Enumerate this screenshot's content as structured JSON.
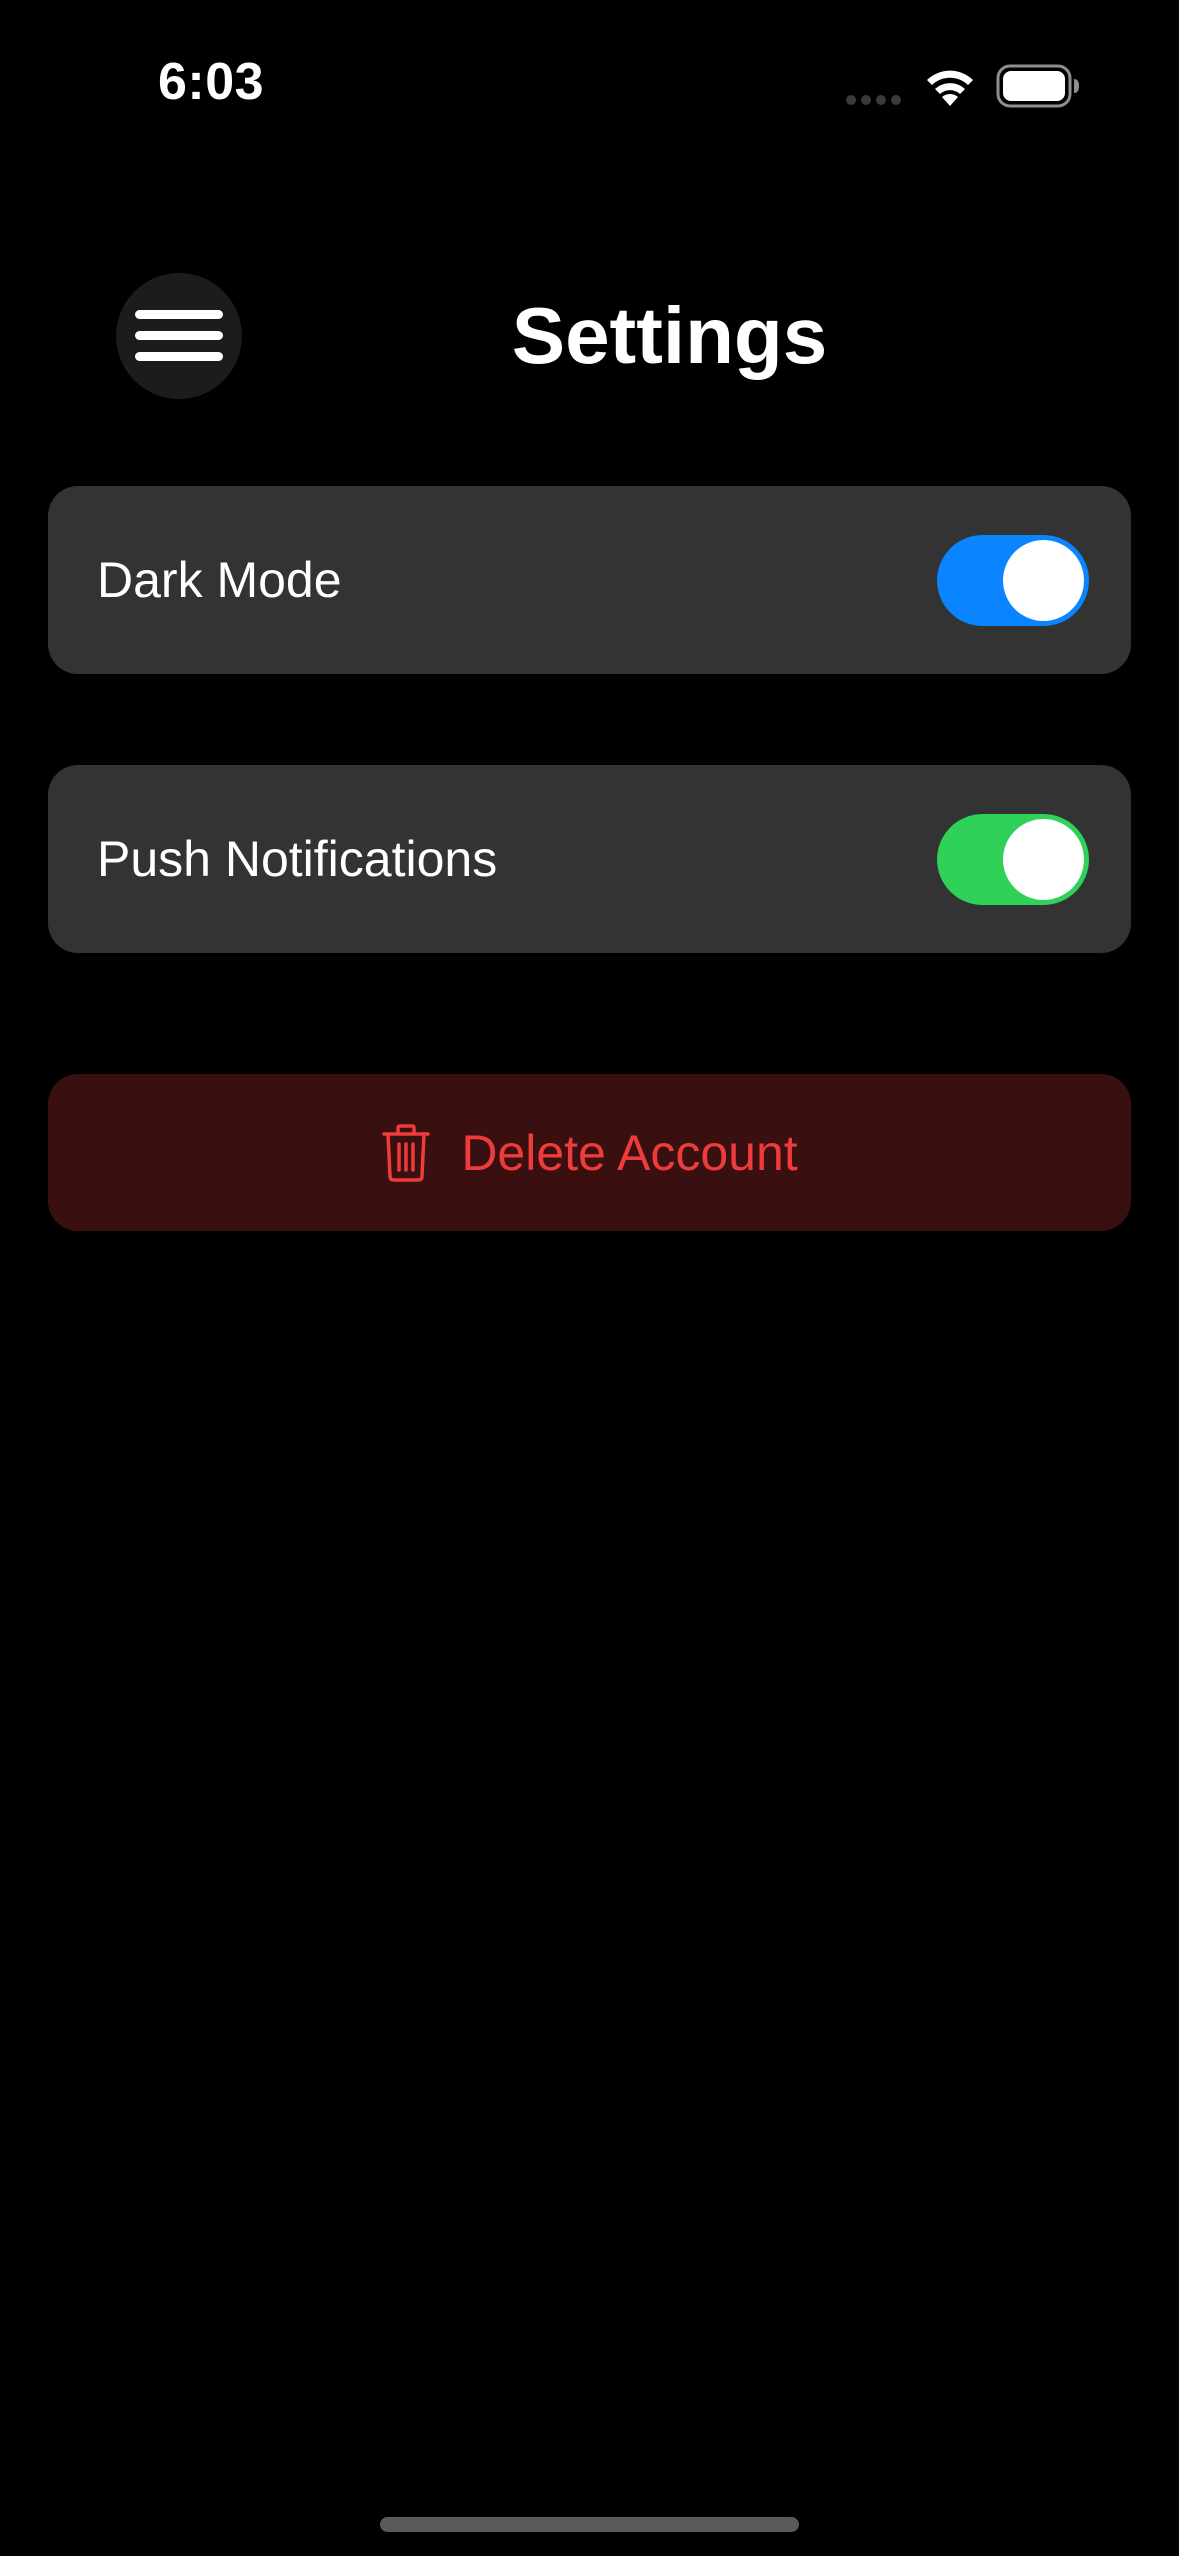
{
  "status_bar": {
    "time": "6:03",
    "wifi_icon": "wifi-icon",
    "battery_icon": "battery-icon",
    "signal_icon": "cellular-dots-icon"
  },
  "header": {
    "title": "Settings",
    "menu_icon": "hamburger-menu-icon"
  },
  "settings": {
    "dark_mode": {
      "label": "Dark Mode",
      "enabled": true,
      "toggle_color": "#0a84ff"
    },
    "push_notifications": {
      "label": "Push Notifications",
      "enabled": true,
      "toggle_color": "#30d158"
    }
  },
  "delete_account": {
    "label": "Delete Account",
    "icon": "trash-icon",
    "text_color": "#ee3b3b",
    "background_color": "#3a0f10"
  },
  "colors": {
    "background": "#000000",
    "card": "#333333",
    "menu_button_bg": "#1c1c1e"
  }
}
